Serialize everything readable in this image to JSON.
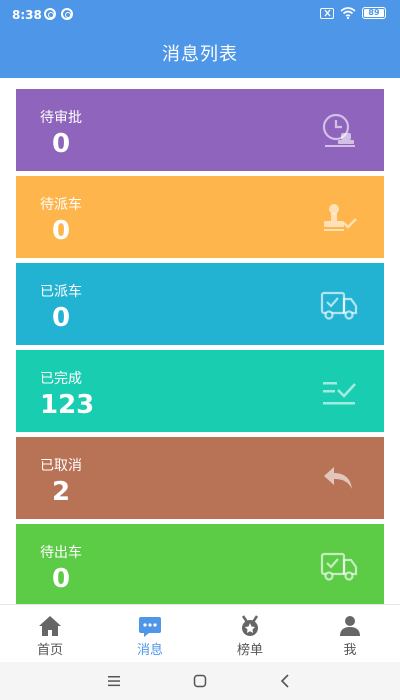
{
  "status": {
    "time": "8:38",
    "battery": "89"
  },
  "header": {
    "title": "消息列表"
  },
  "cards": [
    {
      "label": "待审批",
      "value": "0",
      "color": "#8f64bd",
      "icon": "approval-stamp-clock-icon"
    },
    {
      "label": "待派车",
      "value": "0",
      "color": "#fdb54c",
      "icon": "stamp-check-icon"
    },
    {
      "label": "已派车",
      "value": "0",
      "color": "#22b3d3",
      "icon": "truck-check-icon"
    },
    {
      "label": "已完成",
      "value": "123",
      "color": "#19cdb0",
      "icon": "list-check-icon"
    },
    {
      "label": "已取消",
      "value": "2",
      "color": "#b87256",
      "icon": "reply-arrow-icon"
    },
    {
      "label": "待出车",
      "value": "0",
      "color": "#5ccb45",
      "icon": "truck-check-icon"
    }
  ],
  "nav": [
    {
      "label": "首页",
      "icon": "home-icon",
      "active": false
    },
    {
      "label": "消息",
      "icon": "message-icon",
      "active": true
    },
    {
      "label": "榜单",
      "icon": "medal-icon",
      "active": false
    },
    {
      "label": "我",
      "icon": "user-icon",
      "active": false
    }
  ],
  "colors": {
    "header": "#4e97e8",
    "nav_active": "#4e97e8",
    "nav_inactive": "#555555"
  }
}
